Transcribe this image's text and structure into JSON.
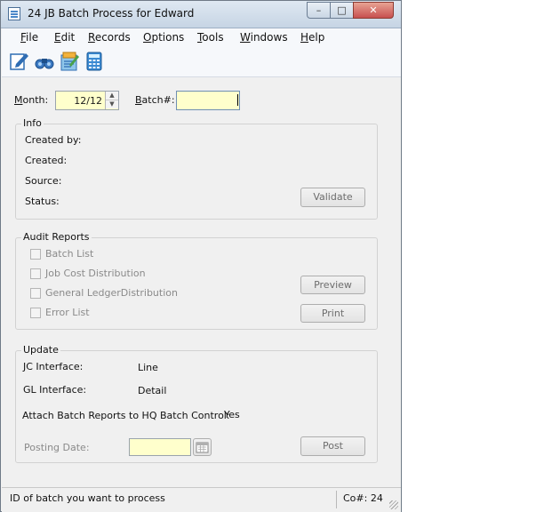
{
  "window": {
    "title": "24 JB Batch Process for Edward",
    "controls": {
      "minimize": "–",
      "maximize": "□",
      "close": "✕"
    }
  },
  "menu": {
    "items": [
      {
        "label": "File",
        "underline": "F",
        "rest": "ile"
      },
      {
        "label": "Edit",
        "underline": "E",
        "rest": "dit"
      },
      {
        "label": "Records",
        "underline": "R",
        "rest": "ecords"
      },
      {
        "label": "Options",
        "underline": "O",
        "rest": "ptions"
      },
      {
        "label": "Tools",
        "underline": "T",
        "rest": "ools"
      },
      {
        "label": "Windows",
        "underline": "W",
        "rest": "indows"
      },
      {
        "label": "Help",
        "underline": "H",
        "rest": "elp"
      }
    ]
  },
  "toolbar": {
    "icons": [
      "edit-form-icon",
      "binoculars-icon",
      "notepad-icon",
      "calculator-icon"
    ]
  },
  "form": {
    "month_label": "Month:",
    "month_value": "12/12",
    "batch_label": "Batch#:",
    "batch_value": ""
  },
  "info": {
    "title": "Info",
    "created_by_label": "Created by:",
    "created_label": "Created:",
    "source_label": "Source:",
    "status_label": "Status:",
    "validate_button": "Validate"
  },
  "audit": {
    "title": "Audit Reports",
    "checks": [
      {
        "label": "Batch List",
        "checked": false
      },
      {
        "label": "Job Cost Distribution",
        "checked": false
      },
      {
        "label": "General LedgerDistribution",
        "checked": false
      },
      {
        "label": "Error List",
        "checked": false
      }
    ],
    "preview_button": "Preview",
    "print_button": "Print"
  },
  "update": {
    "title": "Update",
    "jc_label": "JC Interface:",
    "jc_value": "Line",
    "gl_label": "GL Interface:",
    "gl_value": "Detail",
    "attach_label": "Attach Batch Reports to HQ Batch Control:",
    "attach_value": "Yes",
    "posting_date_label": "Posting Date:",
    "posting_date_value": "",
    "post_button": "Post"
  },
  "status": {
    "message": "ID of batch you want to process",
    "company": "Co#: 24"
  },
  "colors": {
    "input_bg": "#ffffcc",
    "disabled_text": "#8a8a8a",
    "accent_blue": "#2f6db3"
  }
}
